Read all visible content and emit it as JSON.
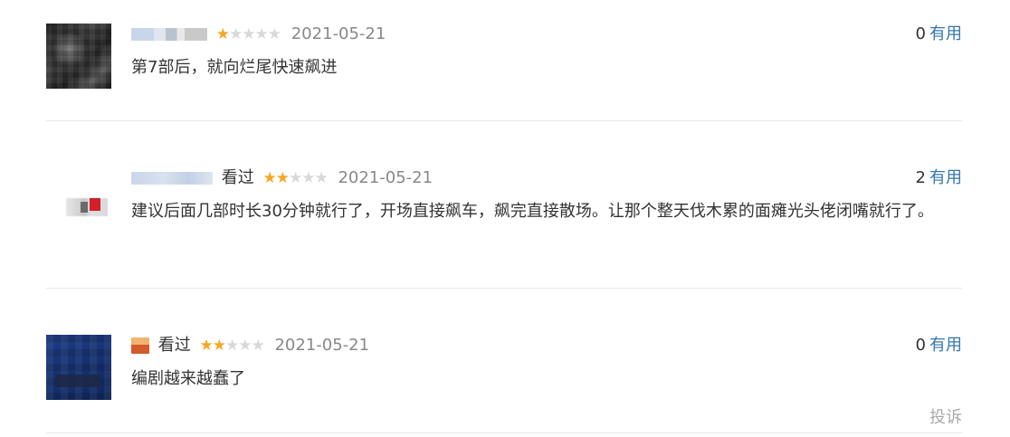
{
  "comments": [
    {
      "status": "",
      "rating": 1,
      "stars": [
        "★",
        "★",
        "★",
        "★",
        "★"
      ],
      "date": "2021-05-21",
      "useful_count": "0",
      "useful_label": "有用",
      "text": "第7部后，就向烂尾快速飙进"
    },
    {
      "status": "看过",
      "rating": 2,
      "stars": [
        "★",
        "★",
        "★",
        "★",
        "★"
      ],
      "date": "2021-05-21",
      "useful_count": "2",
      "useful_label": "有用",
      "text": "建议后面几部时长30分钟就行了，开场直接飙车，飙完直接散场。让那个整天伐木累的面瘫光头佬闭嘴就行了。"
    },
    {
      "status": "看过",
      "rating": 2,
      "stars": [
        "★",
        "★",
        "★",
        "★",
        "★"
      ],
      "date": "2021-05-21",
      "useful_count": "0",
      "useful_label": "有用",
      "text": "编剧越来越蠢了"
    }
  ],
  "footer": {
    "report_label": "投诉"
  },
  "colors": {
    "star_on": "#f5a623",
    "star_off": "#d8d8d8",
    "link": "#3377aa",
    "date": "#888888",
    "divider": "#e8e8e8"
  }
}
